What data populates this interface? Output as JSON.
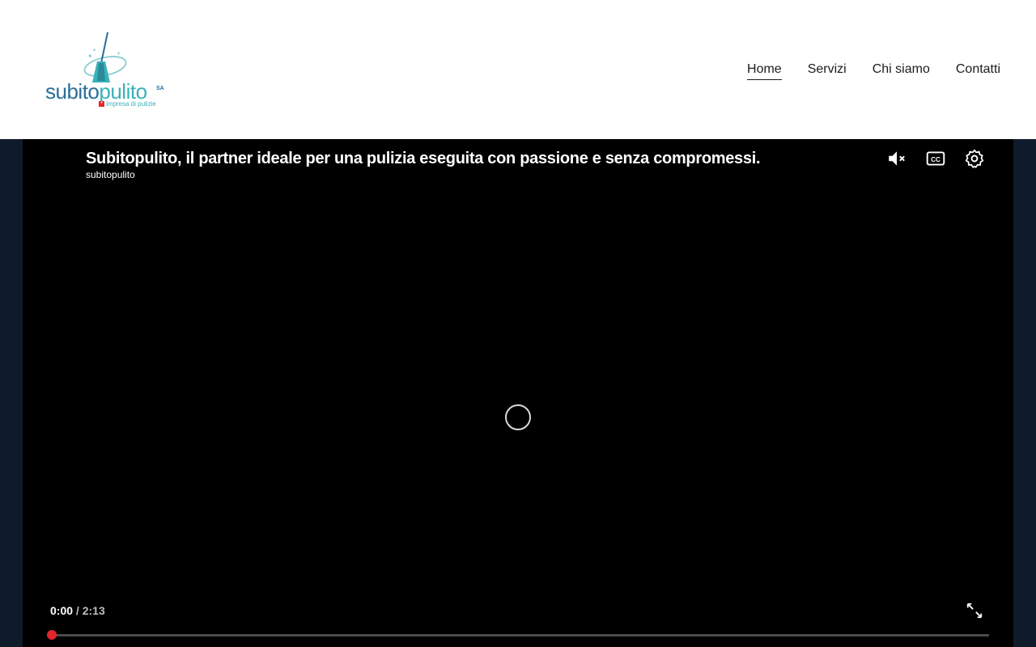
{
  "logo": {
    "word_part1": "subito",
    "word_part2": "pulito",
    "suffix": "SA",
    "tagline": "impresa di pulizie",
    "flag_symbol": "+"
  },
  "nav": {
    "items": [
      {
        "label": "Home",
        "active": true
      },
      {
        "label": "Servizi",
        "active": false
      },
      {
        "label": "Chi siamo",
        "active": false
      },
      {
        "label": "Contatti",
        "active": false
      }
    ]
  },
  "video": {
    "title": "Subitopulito, il partner ideale per una pulizia eseguita con passione e senza compromessi.",
    "channel": "subitopulito",
    "current_time": "0:00",
    "separator": " / ",
    "duration": "2:13",
    "progress_fraction": 0.0,
    "icons": {
      "mute": "volume-muted-icon",
      "captions": "closed-captions-icon",
      "settings": "gear-icon",
      "fullscreen": "fullscreen-icon",
      "loading": "loading-spinner-icon"
    }
  },
  "colors": {
    "header_bg": "#ffffff",
    "page_bg": "#0f1a2a",
    "video_bg": "#000000",
    "brand_blue": "#2a6f97",
    "brand_teal": "#38b2b8",
    "progress_red": "#e3262e"
  }
}
